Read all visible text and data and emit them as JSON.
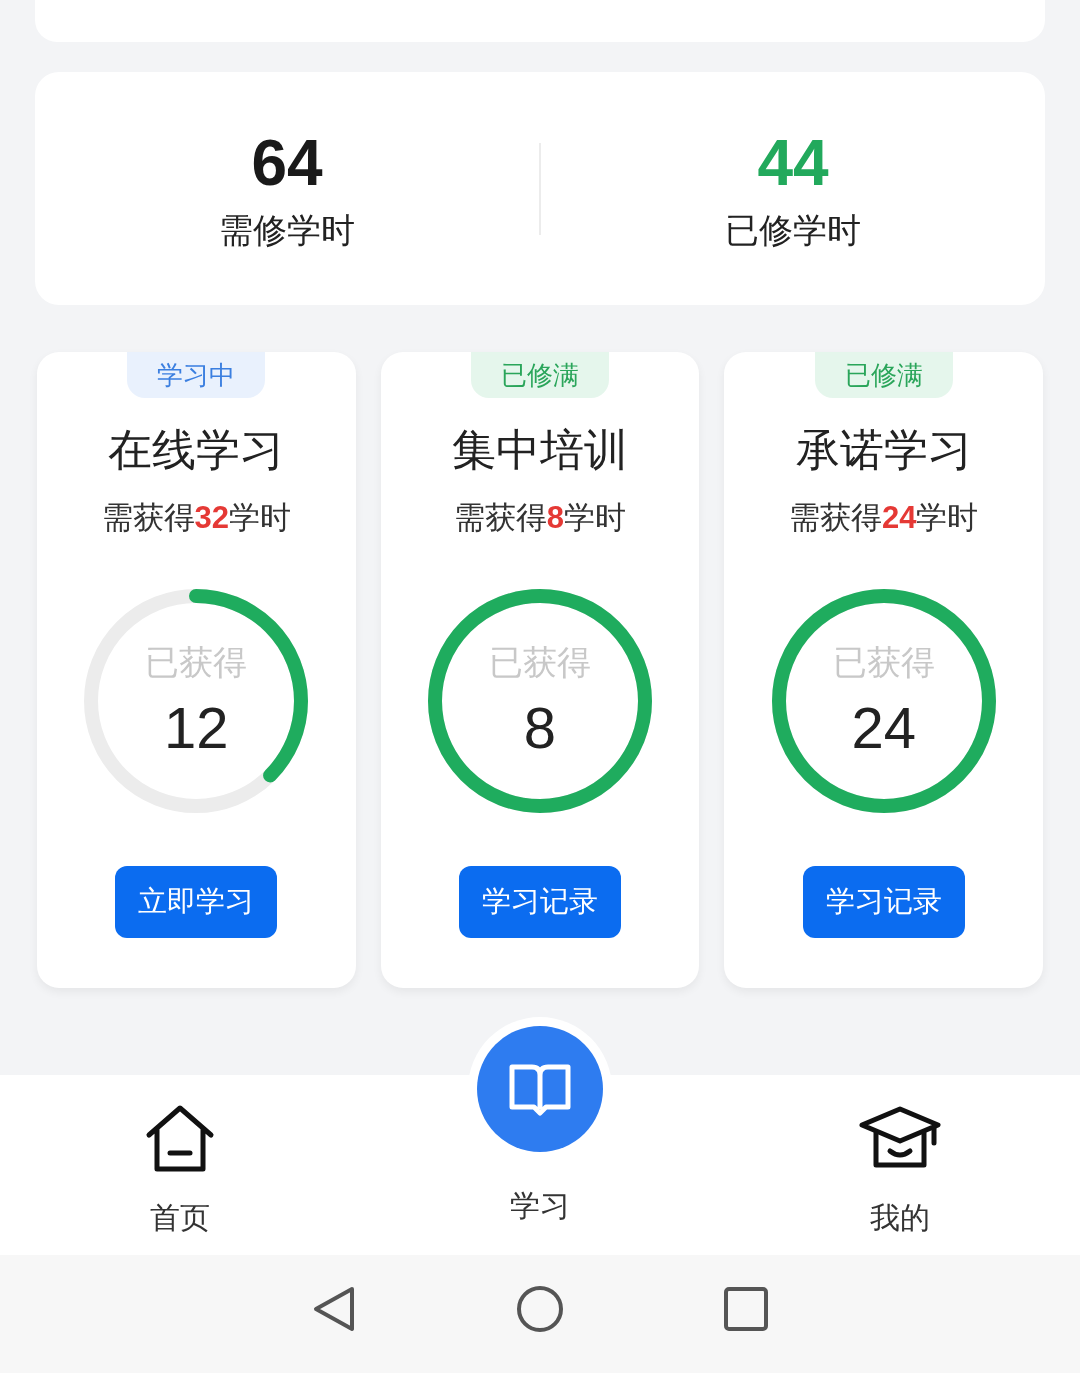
{
  "stats": [
    {
      "value": "64",
      "label": "需修学时",
      "color": "#1a1a1a"
    },
    {
      "value": "44",
      "label": "已修学时",
      "color": "#22a95c"
    }
  ],
  "courses": [
    {
      "badge": "学习中",
      "kind": "studying",
      "title": "在线学习",
      "requirement": "需获得**32**学时",
      "ring_label": "已获得",
      "earned": "12",
      "level": 0.375,
      "button": "立即学习"
    },
    {
      "badge": "已修满",
      "kind": "complete",
      "title": "集中培训",
      "requirement": "需获得**8**学时",
      "ring_label": "已获得",
      "earned": "8",
      "level": 1,
      "button": "学习记录"
    },
    {
      "badge": "已修满",
      "kind": "complete",
      "title": "承诺学习",
      "requirement": "需获得**24**学时",
      "ring_label": "已获得",
      "earned": "24",
      "level": 1,
      "button": "学习记录"
    }
  ],
  "nav": [
    {
      "label": "首页",
      "kind": "home",
      "selected": false
    },
    {
      "label": "学习",
      "kind": "book",
      "selected": true
    },
    {
      "label": "我的",
      "kind": "cap",
      "selected": false
    }
  ]
}
